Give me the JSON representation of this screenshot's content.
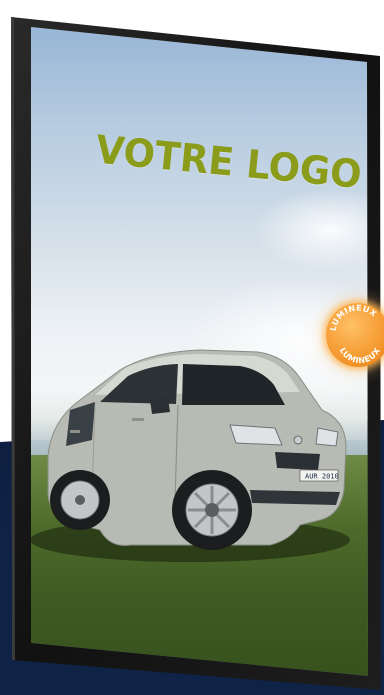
{
  "poster": {
    "logo_text": "VOTRE LOGO",
    "plate_text": "AUR 2010"
  },
  "badge": {
    "top_text": "LUMINEUX",
    "bottom_text": "LUMINEUX"
  },
  "colors": {
    "logo": "#8b9b1a",
    "frame": "#151515",
    "background_band": "#0f2346",
    "badge": "#f7a23b"
  }
}
